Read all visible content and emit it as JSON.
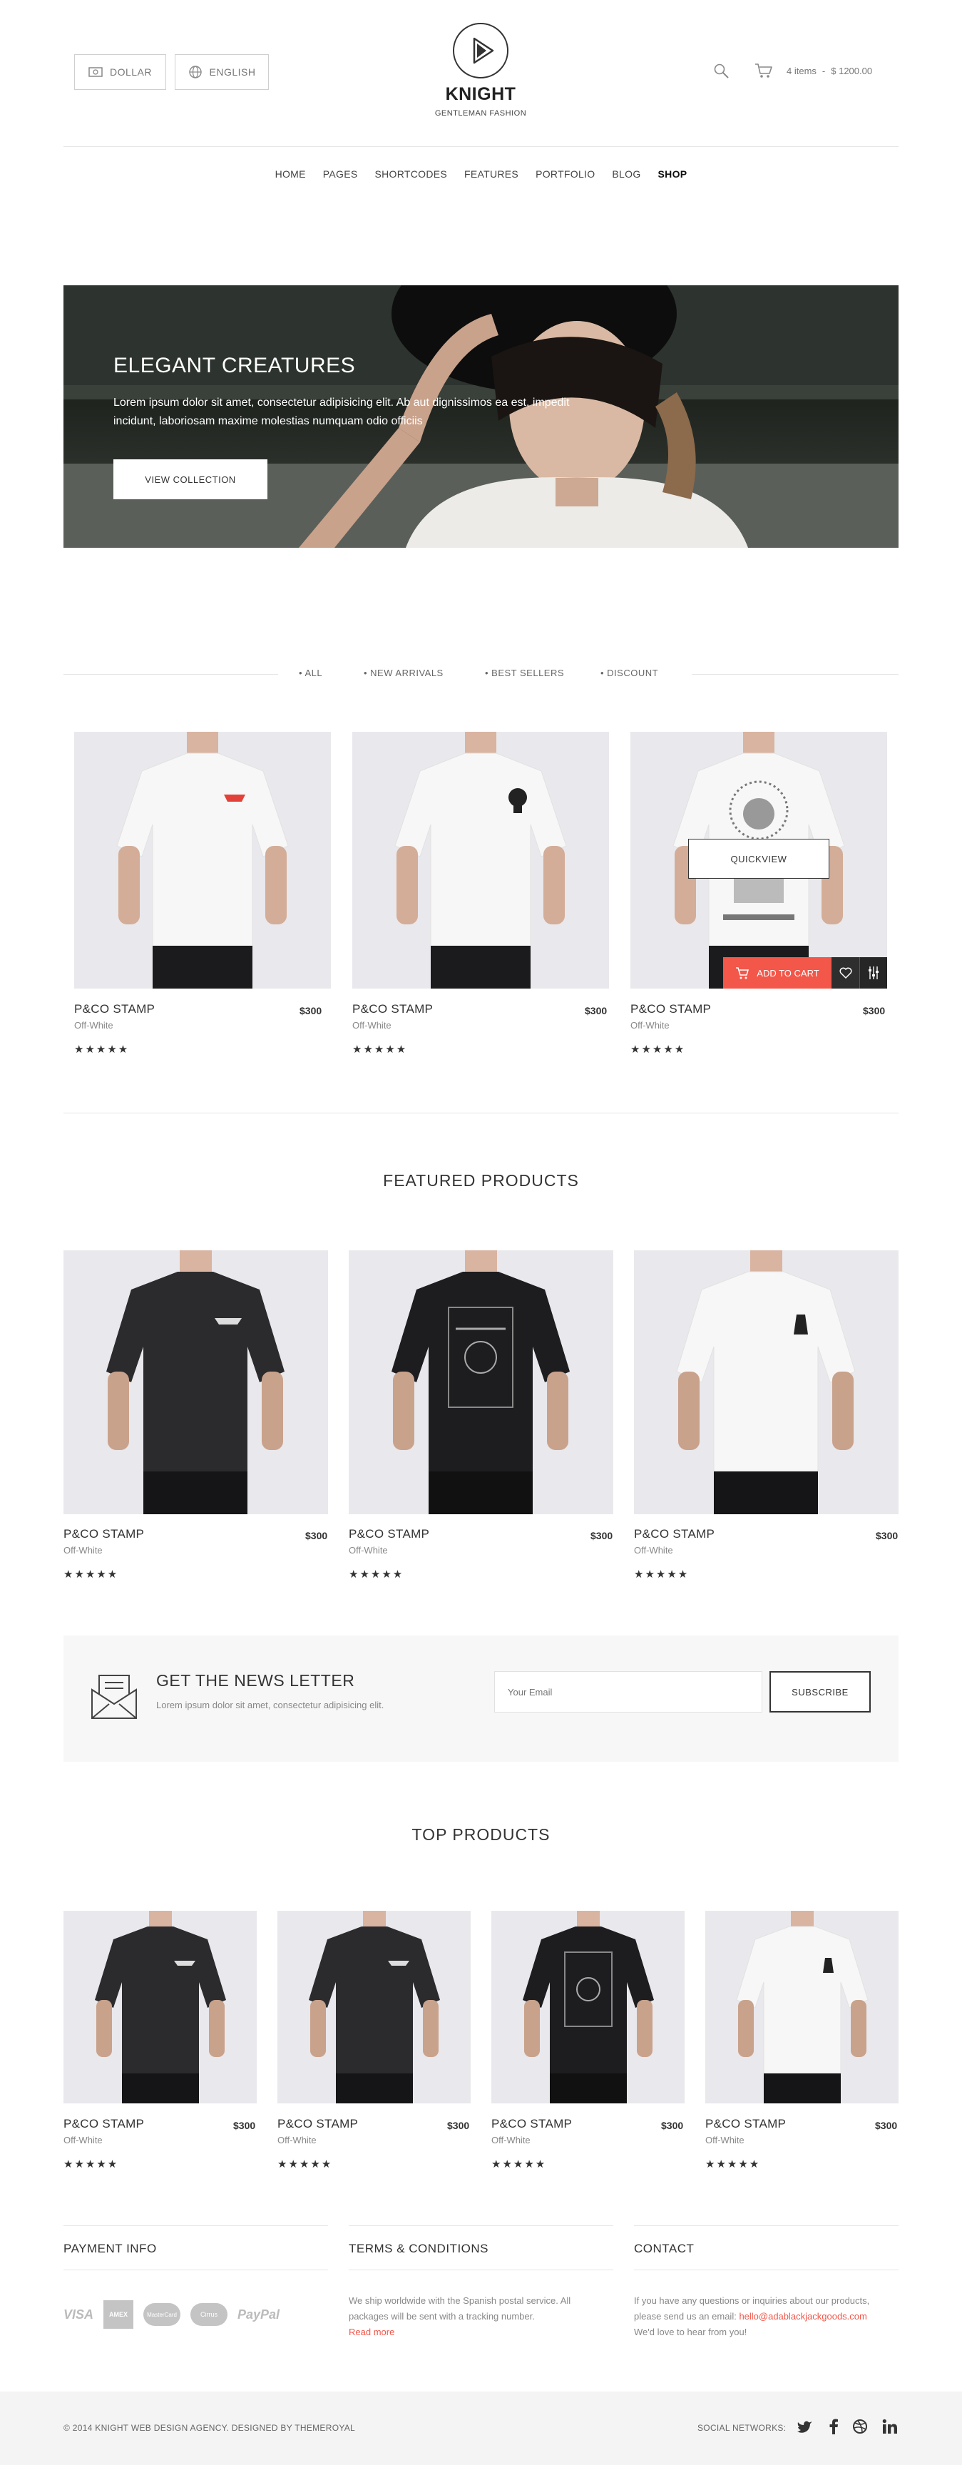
{
  "header": {
    "currency_label": "DOLLAR",
    "language_label": "ENGLISH",
    "logo_title": "KNIGHT",
    "logo_subtitle": "GENTLEMAN FASHION",
    "cart_items": "4 items",
    "cart_separator": "-",
    "cart_total": "$ 1200.00"
  },
  "nav": {
    "items": [
      "HOME",
      "PAGES",
      "SHORTCODES",
      "FEATURES",
      "PORTFOLIO",
      "BLOG",
      "SHOP"
    ],
    "active": "SHOP"
  },
  "hero": {
    "title": "ELEGANT CREATURES",
    "text": "Lorem ipsum dolor sit amet, consectetur adipisicing elit. Ab aut dignissimos ea est, impedit incidunt, laboriosam maxime molestias numquam odio officiis",
    "button": "VIEW COLLECTION"
  },
  "filters": [
    "ALL",
    "NEW ARRIVALS",
    "BEST SELLERS",
    "DISCOUNT"
  ],
  "products_grid": [
    {
      "name": "P&CO STAMP",
      "price": "$300",
      "color": "Off-White",
      "stars": "★★★★★"
    },
    {
      "name": "P&CO STAMP",
      "price": "$300",
      "color": "Off-White",
      "stars": "★★★★★"
    },
    {
      "name": "P&CO STAMP",
      "price": "$300",
      "color": "Off-White",
      "stars": "★★★★★"
    }
  ],
  "quickview": {
    "quickview_label": "QUICKVIEW",
    "add_to_cart_label": "ADD TO CART"
  },
  "featured": {
    "title": "FEATURED PRODUCTS",
    "items": [
      {
        "name": "P&CO STAMP",
        "price": "$300",
        "color": "Off-White",
        "stars": "★★★★★"
      },
      {
        "name": "P&CO STAMP",
        "price": "$300",
        "color": "Off-White",
        "stars": "★★★★★"
      },
      {
        "name": "P&CO STAMP",
        "price": "$300",
        "color": "Off-White",
        "stars": "★★★★★"
      }
    ]
  },
  "newsletter": {
    "title": "GET THE NEWS LETTER",
    "text": "Lorem ipsum dolor sit amet, consectetur adipisicing elit.",
    "placeholder": "Your Email",
    "button": "SUBSCRIBE"
  },
  "top": {
    "title": "TOP PRODUCTS",
    "items": [
      {
        "name": "P&CO STAMP",
        "price": "$300",
        "color": "Off-White",
        "stars": "★★★★★"
      },
      {
        "name": "P&CO STAMP",
        "price": "$300",
        "color": "Off-White",
        "stars": "★★★★★"
      },
      {
        "name": "P&CO STAMP",
        "price": "$300",
        "color": "Off-White",
        "stars": "★★★★★"
      },
      {
        "name": "P&CO STAMP",
        "price": "$300",
        "color": "Off-White",
        "stars": "★★★★★"
      }
    ]
  },
  "footer": {
    "payment_title": "PAYMENT INFO",
    "payment_logos": [
      "VISA",
      "AMEX",
      "MasterCard",
      "Cirrus",
      "PayPal"
    ],
    "terms_title": "TERMS & CONDITIONS",
    "terms_text": "We ship worldwide with the Spanish postal service. All packages will be sent with a tracking number.",
    "terms_link": "Read more",
    "contact_title": "CONTACT",
    "contact_text_1": "If you have any questions or inquiries about our products, please send us an email:",
    "contact_email": "hello@adablackjackgoods.com",
    "contact_text_2": "We'd love to hear from you!",
    "copyright": "© 2014 KNIGHT WEB DESIGN AGENCY. DESIGNED BY THEMEROYAL",
    "social_label": "SOCIAL NETWORKS:",
    "social_icons": [
      "twitter-icon",
      "facebook-icon",
      "dribbble-icon",
      "linkedin-icon"
    ]
  },
  "colors": {
    "accent": "#f2574a",
    "dark": "#333333",
    "footer_bg": "#f4f4f4",
    "shirt_dark": "#2b2b2e",
    "shirt_white": "#f5f5f5"
  }
}
